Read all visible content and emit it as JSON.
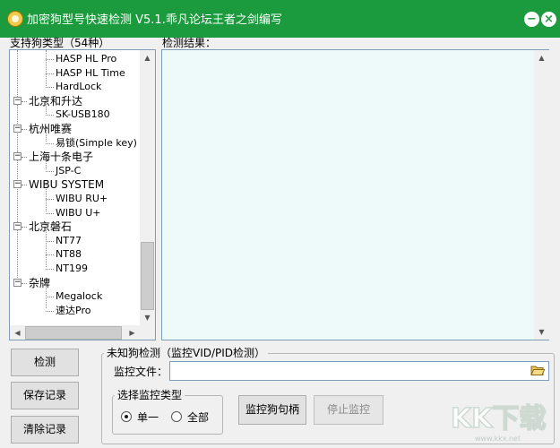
{
  "window": {
    "title": "加密狗型号快速检测 V5.1.乖凡论坛王者之剑编写",
    "min_glyph": "−",
    "close_glyph": "×"
  },
  "labels": {
    "supported_types": "支持狗类型（54种）",
    "results": "检测结果："
  },
  "tree": {
    "items": [
      {
        "label": "HASP HL Pro",
        "level": 1
      },
      {
        "label": "HASP HL Time",
        "level": 1
      },
      {
        "label": "HardLock",
        "level": 1
      },
      {
        "label": "北京和升达",
        "level": 0,
        "expander": "−"
      },
      {
        "label": "SK-USB180",
        "level": 1
      },
      {
        "label": "杭州唯赛",
        "level": 0,
        "expander": "−"
      },
      {
        "label": "易锁(Simple key)",
        "level": 1
      },
      {
        "label": "上海十条电子",
        "level": 0,
        "expander": "−"
      },
      {
        "label": "JSP-C",
        "level": 1
      },
      {
        "label": "WIBU SYSTEM",
        "level": 0,
        "expander": "−"
      },
      {
        "label": "WIBU RU+",
        "level": 1
      },
      {
        "label": "WIBU U+",
        "level": 1
      },
      {
        "label": "北京磐石",
        "level": 0,
        "expander": "−"
      },
      {
        "label": "NT77",
        "level": 1
      },
      {
        "label": "NT88",
        "level": 1
      },
      {
        "label": "NT199",
        "level": 1
      },
      {
        "label": "杂牌",
        "level": 0,
        "expander": "−"
      },
      {
        "label": "Megalock",
        "level": 1
      },
      {
        "label": "速达Pro",
        "level": 1
      }
    ]
  },
  "buttons": {
    "detect": "检测",
    "save_log": "保存记录",
    "clear_log": "清除记录",
    "monitor_handle": "监控狗句柄",
    "stop_monitor": "停止监控"
  },
  "unknown_group": {
    "title": "未知狗检测（监控VID/PID检测）",
    "file_label": "监控文件：",
    "file_value": ""
  },
  "monitor_type": {
    "title": "选择监控类型",
    "options": [
      "单一",
      "全部"
    ],
    "selected": "单一"
  },
  "watermark": {
    "text": "KK下载",
    "url": "www.kkx.net"
  },
  "colors": {
    "titlebar": "#1c9b3e",
    "result_bg": "#edfaf9"
  }
}
